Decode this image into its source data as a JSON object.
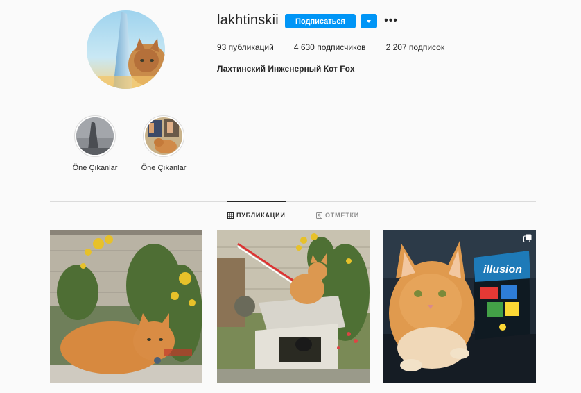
{
  "profile": {
    "username": "lakhtinskii",
    "follow_label": "Подписаться",
    "more_label": "•••",
    "stats": {
      "posts": "93 публикаций",
      "followers": "4 630 подписчиков",
      "following": "2 207 подписок"
    },
    "bio": "Лахтинский Инженерный Кот Fox"
  },
  "highlights": [
    {
      "label": "Öne Çıkanlar"
    },
    {
      "label": "Öne Çıkanlar"
    }
  ],
  "tabs": {
    "posts": "ПУБЛИКАЦИИ",
    "tagged": "ОТМЕТКИ"
  },
  "posts": [
    {
      "icon": ""
    },
    {
      "icon": ""
    },
    {
      "icon": "multiple-photos-icon"
    }
  ],
  "illusion_box_text": "illusion",
  "colors": {
    "accent": "#0095f6",
    "background": "#fafafa",
    "divider": "#dbdbdb",
    "secondary_text": "#8e8e8e"
  }
}
